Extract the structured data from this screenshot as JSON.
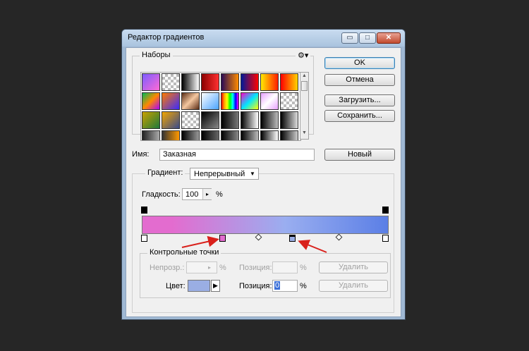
{
  "window": {
    "title": "Редактор градиентов",
    "min_glyph": "▭",
    "max_glyph": "□",
    "close_glyph": "✕"
  },
  "presets": {
    "legend": "Наборы",
    "gear_glyph": "⚙▾"
  },
  "buttons": {
    "ok": "OK",
    "cancel": "Отмена",
    "load": "Загрузить...",
    "save": "Сохранить...",
    "new": "Новый"
  },
  "name_field": {
    "label": "Имя:",
    "value": "Заказная"
  },
  "gradient": {
    "type_label": "Градиент:",
    "type_value": "Непрерывный",
    "smoothness_label": "Гладкость:",
    "smoothness_value": "100",
    "smoothness_unit": "%",
    "color_from": "#e36ccf",
    "color_mid": "#9aaef0",
    "color_to": "#5b7fe6"
  },
  "stops_group": {
    "legend": "Контрольные точки",
    "opacity_label": "Непрозр.:",
    "opacity_unit": "%",
    "opacity_pos_label": "Позиция:",
    "opacity_pos_unit": "%",
    "delete_1": "Удалить",
    "color_label": "Цвет:",
    "color_value": "#9aaee3",
    "color_pos_label": "Позиция:",
    "color_pos_value": "0",
    "color_pos_unit": "%",
    "delete_2": "Удалить"
  },
  "icons": {
    "dropdown": "▼",
    "stepper": "▸",
    "scroll_up": "▲",
    "scroll_down": "▼",
    "color_arrow": "▶"
  }
}
